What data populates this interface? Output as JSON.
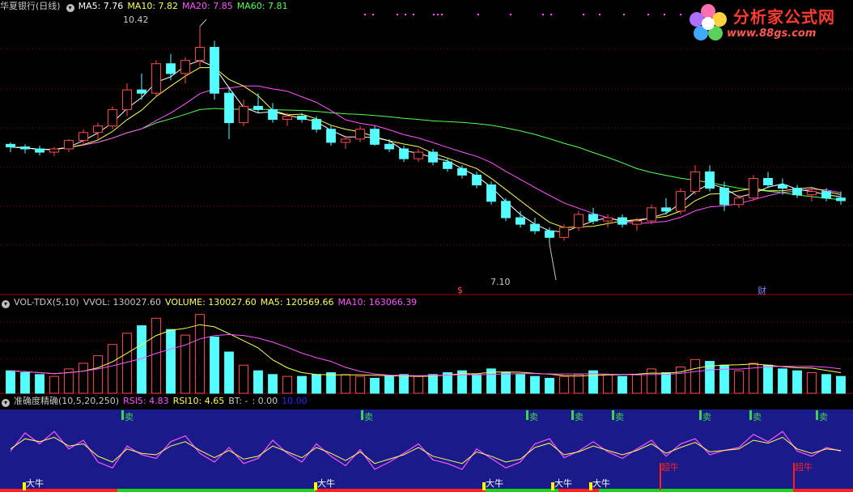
{
  "price_panel": {
    "title": "华夏银行(日线)",
    "ma5": "MA5: 7.76",
    "ma10": "MA10: 7.82",
    "ma20": "MA20: 7.85",
    "ma60": "MA60: 7.81",
    "high_label": "10.42",
    "low_label": "7.10",
    "event_mark_1": "$",
    "event_mark_2": "财"
  },
  "volume_panel": {
    "name": "VOL-TDX(5,10)",
    "vvol": "VVOL: 130027.60",
    "volume": "VOLUME: 130027.60",
    "ma5": "MA5: 120569.66",
    "ma10": "MA10: 163066.39"
  },
  "indicator_panel": {
    "name": "准确度精确(10,5,20,250)",
    "rsi5": "RSI5: 4.83",
    "rsi10": "RSI10: 4.65",
    "bt": "BT: -",
    "v1": ": 0.00",
    "v2": "10.00",
    "sell_label": "卖",
    "big_bull_label": "大牛",
    "super_bull_label": "超牛"
  },
  "logo": {
    "title": "分析家公式网",
    "url": "www.88gs.com"
  },
  "colors": {
    "up": "#ff4b4b",
    "down": "#54ffff",
    "ma5": "#ffffff",
    "ma10": "#ffff54",
    "ma20": "#ff54ff",
    "ma60": "#54ff54",
    "indicator_bg": "#1a1a8a",
    "sell": "#39d84a",
    "bull": "#ffff00"
  },
  "chart_data": {
    "type": "candlestick",
    "price_range": [
      6.5,
      10.6
    ],
    "candles_ohlc": [
      [
        8.62,
        8.65,
        8.5,
        8.58
      ],
      [
        8.58,
        8.62,
        8.48,
        8.55
      ],
      [
        8.55,
        8.6,
        8.45,
        8.5
      ],
      [
        8.5,
        8.58,
        8.44,
        8.55
      ],
      [
        8.55,
        8.7,
        8.5,
        8.68
      ],
      [
        8.68,
        8.85,
        8.6,
        8.8
      ],
      [
        8.8,
        8.95,
        8.7,
        8.9
      ],
      [
        8.9,
        9.2,
        8.85,
        9.15
      ],
      [
        9.15,
        9.55,
        9.05,
        9.45
      ],
      [
        9.45,
        9.7,
        9.3,
        9.4
      ],
      [
        9.4,
        9.9,
        9.35,
        9.85
      ],
      [
        9.85,
        10.0,
        9.6,
        9.7
      ],
      [
        9.7,
        9.95,
        9.55,
        9.9
      ],
      [
        9.9,
        10.42,
        9.8,
        10.1
      ],
      [
        10.1,
        10.2,
        9.3,
        9.4
      ],
      [
        9.4,
        9.5,
        8.7,
        8.95
      ],
      [
        8.95,
        9.3,
        8.9,
        9.2
      ],
      [
        9.2,
        9.4,
        9.1,
        9.15
      ],
      [
        9.15,
        9.25,
        8.95,
        9.0
      ],
      [
        9.0,
        9.1,
        8.9,
        9.05
      ],
      [
        9.05,
        9.1,
        8.95,
        9.0
      ],
      [
        9.0,
        9.05,
        8.8,
        8.85
      ],
      [
        8.85,
        8.9,
        8.6,
        8.65
      ],
      [
        8.65,
        8.75,
        8.55,
        8.7
      ],
      [
        8.7,
        8.9,
        8.65,
        8.85
      ],
      [
        8.85,
        8.9,
        8.6,
        8.62
      ],
      [
        8.62,
        8.7,
        8.5,
        8.55
      ],
      [
        8.55,
        8.6,
        8.35,
        8.4
      ],
      [
        8.4,
        8.55,
        8.35,
        8.5
      ],
      [
        8.5,
        8.55,
        8.3,
        8.35
      ],
      [
        8.35,
        8.4,
        8.2,
        8.25
      ],
      [
        8.25,
        8.3,
        8.1,
        8.15
      ],
      [
        8.15,
        8.2,
        7.95,
        8.0
      ],
      [
        8.0,
        8.05,
        7.7,
        7.75
      ],
      [
        7.75,
        7.8,
        7.45,
        7.5
      ],
      [
        7.5,
        7.6,
        7.35,
        7.4
      ],
      [
        7.4,
        7.5,
        7.25,
        7.3
      ],
      [
        7.3,
        7.35,
        7.1,
        7.2
      ],
      [
        7.2,
        7.4,
        7.15,
        7.35
      ],
      [
        7.35,
        7.6,
        7.3,
        7.55
      ],
      [
        7.55,
        7.65,
        7.4,
        7.45
      ],
      [
        7.45,
        7.55,
        7.35,
        7.5
      ],
      [
        7.5,
        7.55,
        7.35,
        7.4
      ],
      [
        7.4,
        7.5,
        7.3,
        7.45
      ],
      [
        7.45,
        7.7,
        7.4,
        7.65
      ],
      [
        7.65,
        7.8,
        7.55,
        7.6
      ],
      [
        7.6,
        7.95,
        7.55,
        7.9
      ],
      [
        7.9,
        8.3,
        7.85,
        8.2
      ],
      [
        8.2,
        8.3,
        7.9,
        7.95
      ],
      [
        7.95,
        8.05,
        7.6,
        7.7
      ],
      [
        7.7,
        7.85,
        7.65,
        7.8
      ],
      [
        7.8,
        8.15,
        7.75,
        8.1
      ],
      [
        8.1,
        8.2,
        7.95,
        8.0
      ],
      [
        8.0,
        8.1,
        7.85,
        7.95
      ],
      [
        7.95,
        8.0,
        7.8,
        7.85
      ],
      [
        7.85,
        7.95,
        7.75,
        7.9
      ],
      [
        7.9,
        7.95,
        7.75,
        7.8
      ],
      [
        7.8,
        7.9,
        7.7,
        7.76
      ]
    ],
    "volume": [
      1.2,
      1.1,
      1.0,
      0.9,
      1.3,
      1.6,
      2.0,
      2.6,
      3.2,
      3.6,
      4.0,
      3.4,
      3.1,
      4.2,
      3.0,
      2.2,
      1.5,
      1.2,
      1.0,
      0.9,
      0.9,
      1.0,
      1.1,
      1.0,
      0.9,
      0.8,
      0.9,
      1.0,
      0.9,
      1.0,
      1.1,
      1.2,
      1.0,
      1.3,
      1.1,
      1.0,
      0.9,
      0.8,
      0.9,
      1.0,
      1.2,
      1.0,
      0.9,
      1.0,
      1.3,
      1.1,
      1.4,
      1.8,
      1.7,
      1.5,
      1.2,
      1.6,
      1.5,
      1.3,
      1.2,
      1.1,
      1.0,
      0.9
    ],
    "rsi5": [
      45,
      70,
      55,
      72,
      48,
      60,
      30,
      22,
      52,
      40,
      35,
      58,
      66,
      42,
      30,
      50,
      28,
      35,
      60,
      42,
      30,
      55,
      38,
      25,
      47,
      20,
      30,
      42,
      55,
      33,
      28,
      20,
      48,
      35,
      22,
      30,
      55,
      62,
      36,
      45,
      58,
      44,
      35,
      48,
      60,
      38,
      55,
      62,
      40,
      46,
      50,
      68,
      58,
      72,
      45,
      38,
      50,
      45
    ],
    "rsi10": [
      48,
      62,
      58,
      64,
      52,
      55,
      38,
      30,
      48,
      42,
      40,
      52,
      58,
      46,
      36,
      46,
      34,
      38,
      52,
      44,
      36,
      50,
      42,
      32,
      44,
      28,
      34,
      40,
      50,
      38,
      33,
      28,
      44,
      38,
      30,
      34,
      50,
      56,
      40,
      44,
      52,
      46,
      40,
      46,
      55,
      42,
      50,
      57,
      44,
      46,
      48,
      60,
      56,
      64,
      48,
      42,
      48,
      46
    ]
  }
}
